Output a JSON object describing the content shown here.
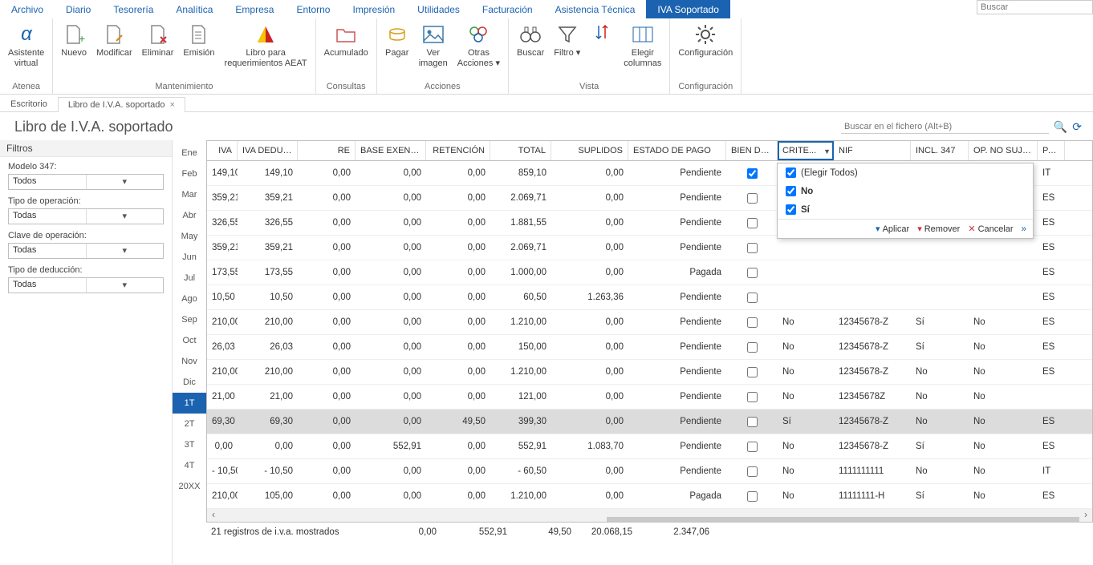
{
  "menubar": {
    "items": [
      "Archivo",
      "Diario",
      "Tesorería",
      "Analítica",
      "Empresa",
      "Entorno",
      "Impresión",
      "Utilidades",
      "Facturación",
      "Asistencia Técnica",
      "IVA Soportado"
    ],
    "active_index": 10,
    "search_placeholder": "Buscar"
  },
  "ribbon": {
    "groups": [
      {
        "label": "Atenea",
        "buttons": [
          {
            "name": "asistente-virtual",
            "label": "Asistente\nvirtual",
            "icon": "alpha"
          }
        ]
      },
      {
        "label": "Mantenimiento",
        "buttons": [
          {
            "name": "nuevo",
            "label": "Nuevo",
            "icon": "doc-plus"
          },
          {
            "name": "modificar",
            "label": "Modificar",
            "icon": "doc-pen"
          },
          {
            "name": "eliminar",
            "label": "Eliminar",
            "icon": "doc-x"
          },
          {
            "name": "emision",
            "label": "Emisión",
            "icon": "doc-list"
          },
          {
            "name": "libro-aeat",
            "label": "Libro para\nrequerimientos AEAT",
            "icon": "aeat"
          }
        ]
      },
      {
        "label": "Consultas",
        "buttons": [
          {
            "name": "acumulado",
            "label": "Acumulado",
            "icon": "folder"
          }
        ]
      },
      {
        "label": "Acciones",
        "buttons": [
          {
            "name": "pagar",
            "label": "Pagar",
            "icon": "coins"
          },
          {
            "name": "ver-imagen",
            "label": "Ver\nimagen",
            "icon": "img"
          },
          {
            "name": "otras-acciones",
            "label": "Otras\nAcciones",
            "icon": "circles",
            "dd": true
          }
        ]
      },
      {
        "label": "Vista",
        "buttons": [
          {
            "name": "buscar",
            "label": "Buscar",
            "icon": "binoc"
          },
          {
            "name": "filtro",
            "label": "Filtro",
            "icon": "funnel",
            "dd": true
          },
          {
            "name": "sort",
            "label": "",
            "icon": "sort"
          },
          {
            "name": "elegir-columnas",
            "label": "Elegir\ncolumnas",
            "icon": "cols"
          }
        ]
      },
      {
        "label": "Configuración",
        "buttons": [
          {
            "name": "configuracion",
            "label": "Configuración",
            "icon": "gear"
          }
        ]
      }
    ]
  },
  "tabs": [
    {
      "label": "Escritorio",
      "active": false,
      "closable": false
    },
    {
      "label": "Libro de I.V.A. soportado",
      "active": true,
      "closable": true
    }
  ],
  "page_title": "Libro de I.V.A. soportado",
  "search_file_placeholder": "Buscar en el fichero (Alt+B)",
  "filters": {
    "title": "Filtros",
    "fields": [
      {
        "label": "Modelo 347:",
        "value": "Todos"
      },
      {
        "label": "Tipo de operación:",
        "value": "Todas"
      },
      {
        "label": "Clave de operación:",
        "value": "Todas"
      },
      {
        "label": "Tipo de deducción:",
        "value": "Todas"
      }
    ]
  },
  "months": [
    "Ene",
    "Feb",
    "Mar",
    "Abr",
    "May",
    "Jun",
    "Jul",
    "Ago",
    "Sep",
    "Oct",
    "Nov",
    "Dic",
    "1T",
    "2T",
    "3T",
    "4T",
    "20XX"
  ],
  "month_selected_index": 12,
  "grid": {
    "columns": [
      "IVA",
      "IVA DEDUCI...",
      "RE",
      "BASE EXENTA",
      "RETENCIÓN",
      "TOTAL",
      "SUPLIDOS",
      "ESTADO DE PAGO",
      "BIEN DE I...",
      "CRITE...",
      "NIF",
      "INCL. 347",
      "OP. NO SUJETA",
      "PAÍS"
    ],
    "active_col_index": 9,
    "rows": [
      {
        "iva": "149,10",
        "ded": "149,10",
        "re": "0,00",
        "base": "0,00",
        "ret": "0,00",
        "total": "859,10",
        "sup": "0,00",
        "estado": "Pendiente",
        "bien": true,
        "crite": "",
        "nif": "",
        "incl": "",
        "opno": "",
        "pais": "IT"
      },
      {
        "iva": "359,21",
        "ded": "359,21",
        "re": "0,00",
        "base": "0,00",
        "ret": "0,00",
        "total": "2.069,71",
        "sup": "0,00",
        "estado": "Pendiente",
        "bien": false,
        "crite": "",
        "nif": "",
        "incl": "",
        "opno": "",
        "pais": "ES"
      },
      {
        "iva": "326,55",
        "ded": "326,55",
        "re": "0,00",
        "base": "0,00",
        "ret": "0,00",
        "total": "1.881,55",
        "sup": "0,00",
        "estado": "Pendiente",
        "bien": false,
        "crite": "",
        "nif": "",
        "incl": "",
        "opno": "",
        "pais": "ES"
      },
      {
        "iva": "359,21",
        "ded": "359,21",
        "re": "0,00",
        "base": "0,00",
        "ret": "0,00",
        "total": "2.069,71",
        "sup": "0,00",
        "estado": "Pendiente",
        "bien": false,
        "crite": "",
        "nif": "",
        "incl": "",
        "opno": "",
        "pais": "ES"
      },
      {
        "iva": "173,55",
        "ded": "173,55",
        "re": "0,00",
        "base": "0,00",
        "ret": "0,00",
        "total": "1.000,00",
        "sup": "0,00",
        "estado": "Pagada",
        "bien": false,
        "crite": "",
        "nif": "",
        "incl": "",
        "opno": "",
        "pais": "ES"
      },
      {
        "iva": "10,50",
        "ded": "10,50",
        "re": "0,00",
        "base": "0,00",
        "ret": "0,00",
        "total": "60,50",
        "sup": "1.263,36",
        "estado": "Pendiente",
        "bien": false,
        "crite": "",
        "nif": "",
        "incl": "",
        "opno": "",
        "pais": "ES"
      },
      {
        "iva": "210,00",
        "ded": "210,00",
        "re": "0,00",
        "base": "0,00",
        "ret": "0,00",
        "total": "1.210,00",
        "sup": "0,00",
        "estado": "Pendiente",
        "bien": false,
        "crite": "No",
        "nif": "12345678-Z",
        "incl": "Sí",
        "opno": "No",
        "pais": "ES"
      },
      {
        "iva": "26,03",
        "ded": "26,03",
        "re": "0,00",
        "base": "0,00",
        "ret": "0,00",
        "total": "150,00",
        "sup": "0,00",
        "estado": "Pendiente",
        "bien": false,
        "crite": "No",
        "nif": "12345678-Z",
        "incl": "Sí",
        "opno": "No",
        "pais": "ES"
      },
      {
        "iva": "210,00",
        "ded": "210,00",
        "re": "0,00",
        "base": "0,00",
        "ret": "0,00",
        "total": "1.210,00",
        "sup": "0,00",
        "estado": "Pendiente",
        "bien": false,
        "crite": "No",
        "nif": "12345678-Z",
        "incl": "No",
        "opno": "No",
        "pais": "ES"
      },
      {
        "iva": "21,00",
        "ded": "21,00",
        "re": "0,00",
        "base": "0,00",
        "ret": "0,00",
        "total": "121,00",
        "sup": "0,00",
        "estado": "Pendiente",
        "bien": false,
        "crite": "No",
        "nif": "12345678Z",
        "incl": "No",
        "opno": "No",
        "pais": ""
      },
      {
        "iva": "69,30",
        "ded": "69,30",
        "re": "0,00",
        "base": "0,00",
        "ret": "49,50",
        "total": "399,30",
        "sup": "0,00",
        "estado": "Pendiente",
        "bien": false,
        "crite": "Sí",
        "nif": "12345678-Z",
        "incl": "No",
        "opno": "No",
        "pais": "ES",
        "selected": true
      },
      {
        "iva": "0,00",
        "ded": "0,00",
        "re": "0,00",
        "base": "552,91",
        "ret": "0,00",
        "total": "552,91",
        "sup": "1.083,70",
        "estado": "Pendiente",
        "bien": false,
        "crite": "No",
        "nif": "12345678-Z",
        "incl": "Sí",
        "opno": "No",
        "pais": "ES"
      },
      {
        "iva": "- 10,50",
        "ded": "- 10,50",
        "re": "0,00",
        "base": "0,00",
        "ret": "0,00",
        "total": "- 60,50",
        "sup": "0,00",
        "estado": "Pendiente",
        "bien": false,
        "crite": "No",
        "nif": "1111111111",
        "incl": "No",
        "opno": "No",
        "pais": "IT"
      },
      {
        "iva": "210,00",
        "ded": "105,00",
        "re": "0,00",
        "base": "0,00",
        "ret": "0,00",
        "total": "1.210,00",
        "sup": "0,00",
        "estado": "Pagada",
        "bien": false,
        "crite": "No",
        "nif": "11111111-H",
        "incl": "Sí",
        "opno": "No",
        "pais": "ES"
      }
    ],
    "footer_label": "21 registros de i.v.a. mostrados",
    "footer_totals": {
      "re": "0,00",
      "base": "552,91",
      "ret": "49,50",
      "total": "20.068,15",
      "sup": "2.347,06"
    }
  },
  "popup": {
    "options": [
      {
        "label": "(Elegir Todos)",
        "checked": true
      },
      {
        "label": "No",
        "checked": true,
        "bold": true
      },
      {
        "label": "Sí",
        "checked": true,
        "bold": true
      }
    ],
    "btn_apply": "Aplicar",
    "btn_remove": "Remover",
    "btn_cancel": "Cancelar"
  }
}
